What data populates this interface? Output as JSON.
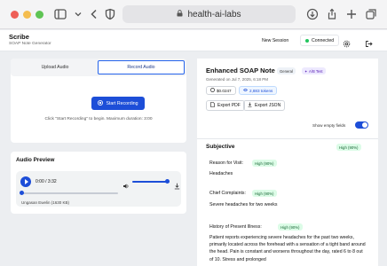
{
  "browser": {
    "url": "health-ai-labs"
  },
  "app": {
    "title": "Scribe",
    "subtitle": "SOAP Note Generator",
    "new_session": "New Session",
    "status": "Connected"
  },
  "left": {
    "tabs": [
      {
        "label": "Upload Audio"
      },
      {
        "label": "Record Audio"
      }
    ],
    "record_button": "Start Recording",
    "record_hint": "Click \"Start Recording\" to begin. Maximum duration: 3:00",
    "audio_preview_title": "Audio Preview",
    "player": {
      "time": "0:00 / 3:32",
      "file_name": "Ungasan Ewelin",
      "file_size": "(1630 KB)",
      "progress": 0,
      "volume": 0.9
    }
  },
  "right": {
    "title": "Enhanced SOAP Note",
    "badge_general": "General",
    "badge_ab": "A/B Test",
    "generated": "Generated on Jul 7, 2025, 6:18 PM",
    "cost": "$0.0247",
    "tokens": "2,883 tokens",
    "export_pdf": "Export PDF",
    "export_json": "Export JSON",
    "show_empty": "Show empty fields",
    "show_empty_on": true,
    "section": {
      "title": "Subjective",
      "badge": "High (90%)",
      "fields": [
        {
          "label": "Reason for Visit:",
          "badge": "High (90%)",
          "value": "Headaches"
        },
        {
          "label": "Chief Complaints:",
          "badge": "High (90%)",
          "value": "Severe headaches for two weeks"
        },
        {
          "label": "History of Present Illness:",
          "badge": "High (90%)",
          "value": "Patient reports experiencing severe headaches for the past two weeks, primarily located across the forehead with a sensation of a tight band around the head. Pain is constant and worsens throughout the day, rated 6 to 8 out of 10. Stress and prolonged"
        }
      ]
    }
  },
  "colors": {
    "accent": "#1d4ed8",
    "success": "#22c55e",
    "confidence_bg": "#dcfce7"
  }
}
